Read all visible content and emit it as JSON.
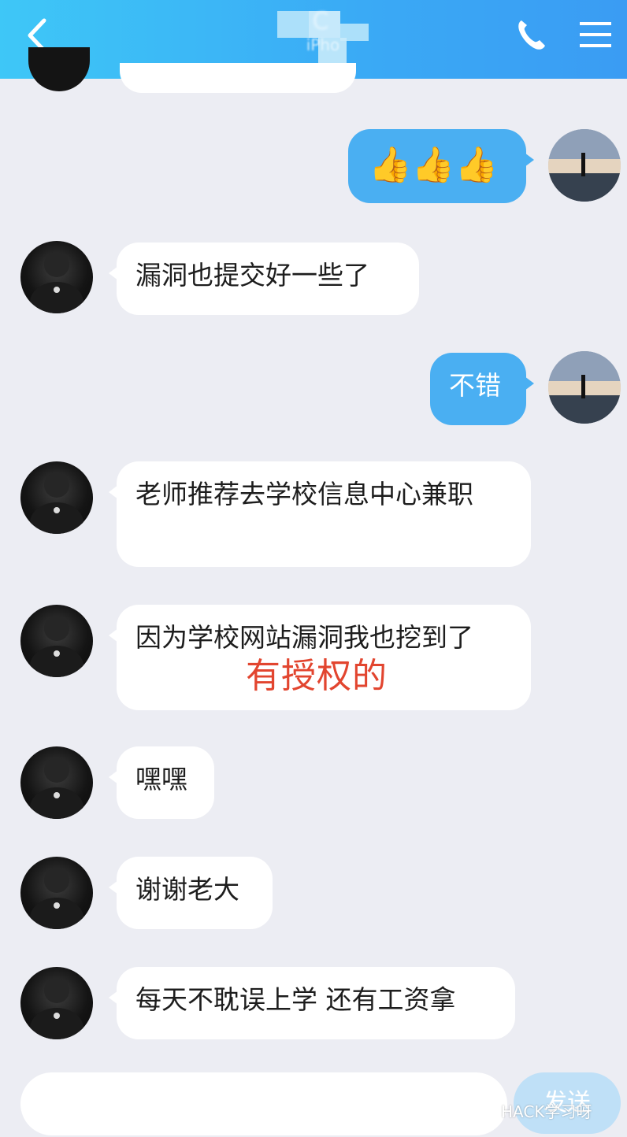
{
  "header": {
    "title": "C",
    "subtitle": "iPho"
  },
  "messages": [
    {
      "sender": "self",
      "type": "emoji",
      "text": "👍👍👍"
    },
    {
      "sender": "other",
      "text": "漏洞也提交好一些了"
    },
    {
      "sender": "self",
      "text": "不错"
    },
    {
      "sender": "other",
      "text": "老师推荐去学校信息中心兼职"
    },
    {
      "sender": "other",
      "text": "因为学校网站漏洞我也挖到了"
    },
    {
      "sender": "other",
      "text": "嘿嘿"
    },
    {
      "sender": "other",
      "text": "谢谢老大"
    },
    {
      "sender": "other",
      "text": "每天不耽误上学 还有工资拿"
    }
  ],
  "overlay_annotation": "有授权的",
  "composer": {
    "send_label": "发送"
  },
  "watermark": "HACK学习呀",
  "colors": {
    "header": "#3aa9f5",
    "self_bubble": "#4aaff2",
    "other_bubble": "#ffffff",
    "background": "#ecedf3",
    "annotation": "#e2452f"
  }
}
